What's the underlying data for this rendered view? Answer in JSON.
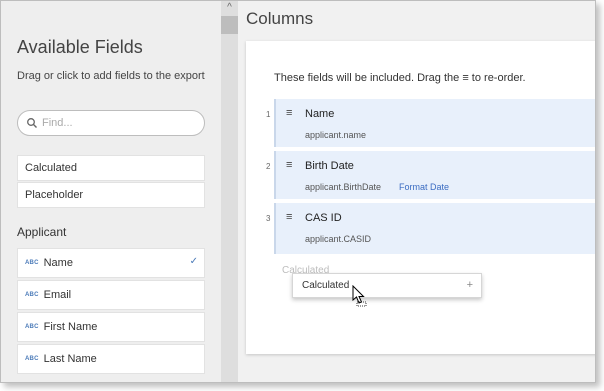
{
  "left_panel": {
    "title": "Available Fields",
    "subtitle": "Drag or click to add fields to the export",
    "search": {
      "placeholder": "Find..."
    },
    "special_fields": [
      {
        "label": "Calculated"
      },
      {
        "label": "Placeholder"
      }
    ],
    "section_title": "Applicant",
    "applicant_fields": [
      {
        "type": "ABC",
        "label": "Name",
        "selected": true
      },
      {
        "type": "ABC",
        "label": "Email"
      },
      {
        "type": "ABC",
        "label": "First Name"
      },
      {
        "type": "ABC",
        "label": "Last Name"
      }
    ]
  },
  "right_panel": {
    "title": "Columns",
    "hint": "These fields will be included. Drag the ≡ to re-order.",
    "columns": [
      {
        "number": "1",
        "name": "Name",
        "path": "applicant.name"
      },
      {
        "number": "2",
        "name": "Birth Date",
        "path": "applicant.BirthDate",
        "link": "Format Date"
      },
      {
        "number": "3",
        "name": "CAS ID",
        "path": "applicant.CASID"
      }
    ],
    "drop_placeholder": "Calculated",
    "drag_chip": {
      "label": "Calculated",
      "plus": "+"
    }
  },
  "icons": {
    "search": "search-icon",
    "drag": "drag-handle-icon",
    "check": "check-icon",
    "scroll_up": "chevron-up-icon",
    "cursor": "move-cursor-icon"
  },
  "colors": {
    "accent": "#3b6cc2",
    "column_bg": "#e8f0fb"
  }
}
